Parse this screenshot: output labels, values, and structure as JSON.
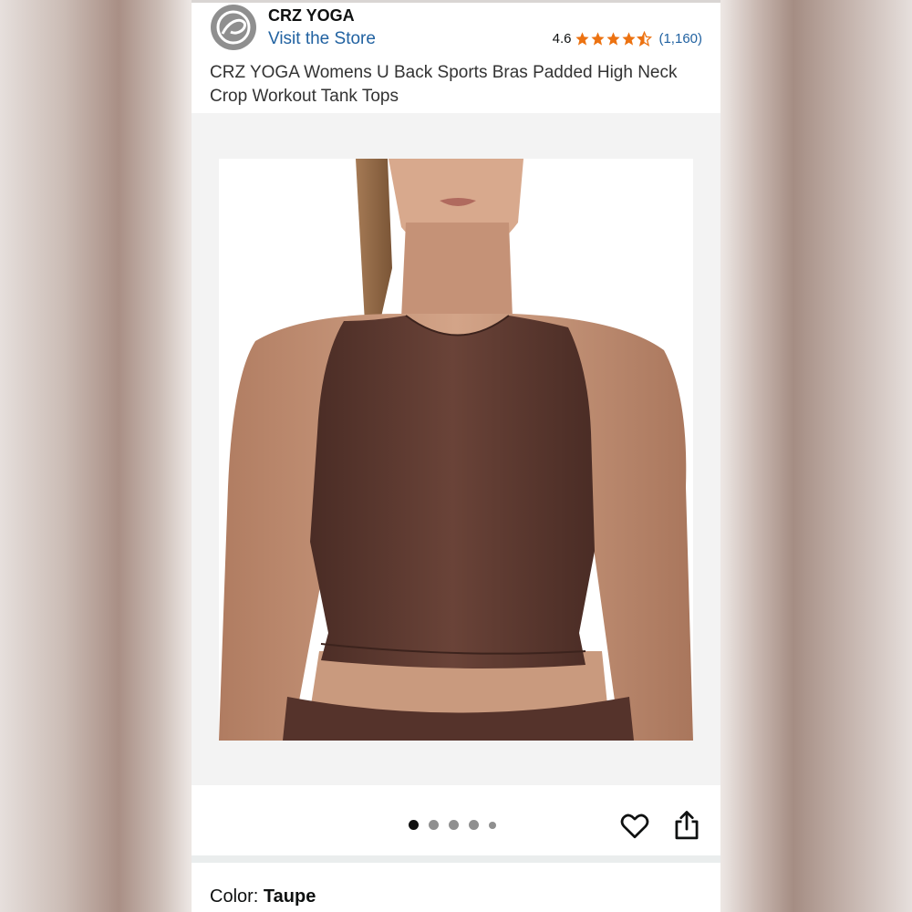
{
  "header": {
    "brand_name": "CRZ YOGA",
    "store_link": "Visit the Store",
    "logo_icon": "crz-yoga-logo-icon",
    "rating": {
      "value": "4.6",
      "stars": 4.5,
      "star_color": "#ec7211",
      "count": "(1,160)"
    }
  },
  "product": {
    "title": "CRZ YOGA Womens U Back Sports Bras Padded High Neck Crop Workout Tank Tops",
    "image_subject": "product-photo-brown-high-neck-crop-tank",
    "garment_color": "#5c3930"
  },
  "gallery": {
    "total_dots": 5,
    "active_index": 0
  },
  "actions": {
    "favorite_icon": "heart-icon",
    "share_icon": "share-icon"
  },
  "color_selection": {
    "label": "Color: ",
    "value": "Taupe"
  },
  "colors": {
    "link": "#2162a1",
    "text": "#0f1111"
  }
}
